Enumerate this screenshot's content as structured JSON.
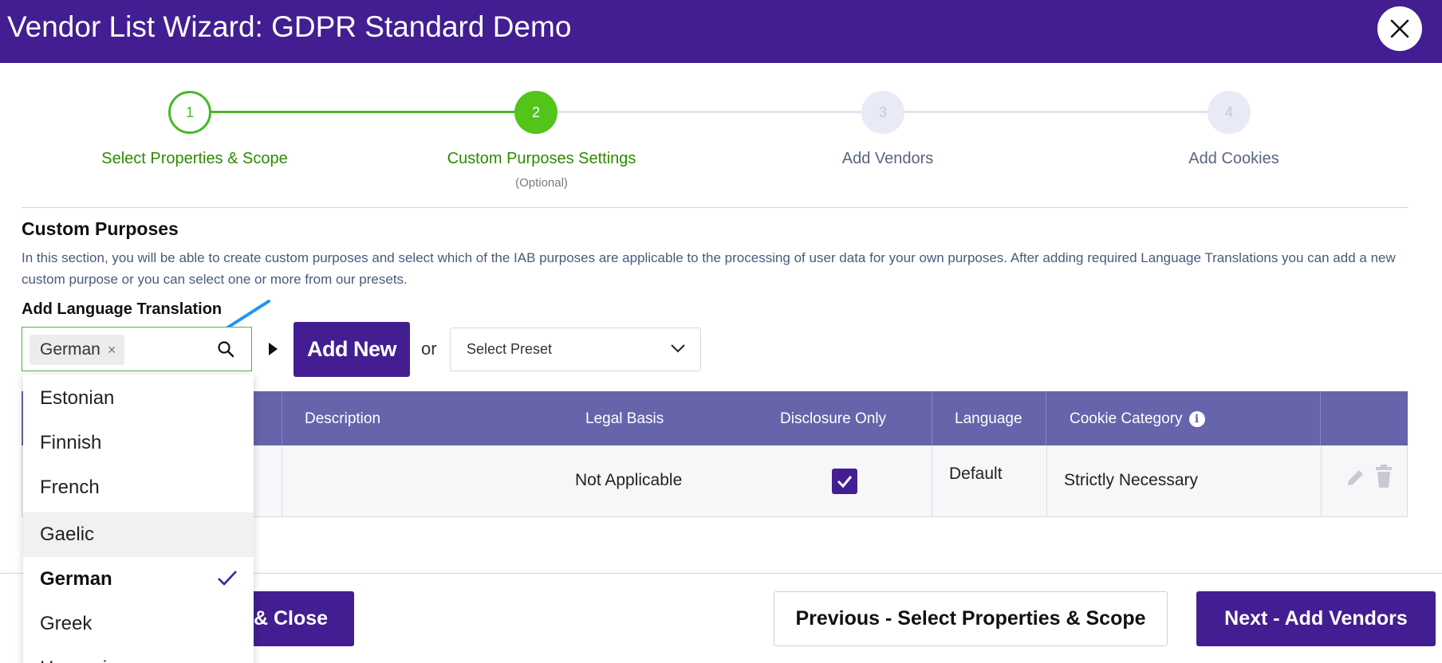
{
  "header": {
    "title": "Vendor List Wizard: GDPR Standard Demo"
  },
  "steps": [
    {
      "number": "1",
      "label": "Select Properties & Scope",
      "sub": "",
      "status": "completed"
    },
    {
      "number": "2",
      "label": "Custom Purposes Settings",
      "sub": "(Optional)",
      "status": "active"
    },
    {
      "number": "3",
      "label": "Add Vendors",
      "sub": "",
      "status": "pending"
    },
    {
      "number": "4",
      "label": "Add Cookies",
      "sub": "",
      "status": "pending"
    }
  ],
  "section": {
    "title": "Custom Purposes",
    "description": "In this section, you will be able to create custom purposes and select which of the IAB purposes are applicable to the processing of user data for your own purposes. After adding required Language Translations you can add a new custom purpose or you can select one or more from our presets.",
    "language_label": "Add Language Translation"
  },
  "language_select": {
    "selected_chip": "German"
  },
  "add_new_label": "Add New",
  "or_text": "or",
  "preset_select": {
    "value": "Select Preset"
  },
  "table": {
    "headers": {
      "description": "Description",
      "legal_basis": "Legal Basis",
      "disclosure_only": "Disclosure Only",
      "language": "Language",
      "cookie_category": "Cookie Category"
    },
    "rows": [
      {
        "legal_basis": "Not Applicable",
        "disclosure_only": true,
        "language": "Default",
        "cookie_category": "Strictly Necessary"
      }
    ]
  },
  "dropdown": {
    "items": [
      "Estonian",
      "Finnish",
      "French",
      "Gaelic",
      "German",
      "Greek",
      "Hungarian"
    ],
    "hovered": "Gaelic",
    "selected": "German"
  },
  "footer": {
    "save_close_label": "& Close",
    "previous_label": "Previous - Select Properties & Scope",
    "next_label": "Next - Add Vendors"
  },
  "colors": {
    "brand_purple": "#421e92",
    "table_header": "#6664ab",
    "step_green": "#48b826",
    "step_text_green": "#2f8a00"
  }
}
